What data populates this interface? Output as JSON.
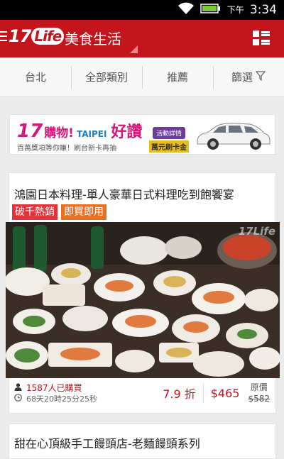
{
  "status": {
    "time": "3:34",
    "ampm": "下午"
  },
  "app": {
    "logo_text": "17",
    "logo_badge": "Life",
    "title": "美食生活"
  },
  "filters": [
    {
      "label": "台北"
    },
    {
      "label": "全部類別"
    },
    {
      "label": "推薦"
    },
    {
      "label": "篩選"
    }
  ],
  "banner": {
    "brand": "17",
    "shop": "購物!",
    "taipei": "TAIPEI",
    "good": "好讚",
    "detail": "活動詳情",
    "subtitle": "百萬獎項等你賺！刷台新卡再抽",
    "card": "萬元刷卡金"
  },
  "deal": {
    "title": "鴻園日本料理-單人豪華日式料理吃到飽饗宴",
    "tags": [
      "破千熱銷",
      "即買即用"
    ],
    "watermark": "17Life",
    "buyers": "1587人已購買",
    "countdown": "68天20時25分25秒",
    "discount": "7.9 折",
    "price": "$465",
    "orig_label": "原價",
    "orig_price": "$582"
  },
  "deal2": {
    "title": "甜在心頂級手工饅頭店-老麵饅頭系列"
  },
  "colors": {
    "brand_red": "#c4141c",
    "tag_hot": "#e2343c",
    "tag_now": "#e97022"
  }
}
